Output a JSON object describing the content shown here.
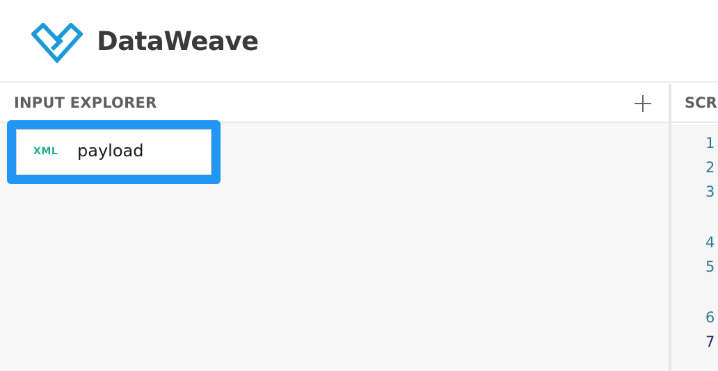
{
  "header": {
    "brand": "DataWeave",
    "logo_icon": "dataweave-logo-icon",
    "logo_color": "#1a9bd7"
  },
  "input_explorer": {
    "title": "INPUT EXPLORER",
    "add_icon": "plus-icon",
    "items": [
      {
        "type": "XML",
        "name": "payload",
        "selected": true
      }
    ],
    "selection_color": "#2196f3",
    "badge_color": "#1fae8c"
  },
  "script_panel": {
    "title": "SCRIPT",
    "line_numbers": [
      "1",
      "2",
      "3",
      "4",
      "5",
      "6",
      "7"
    ]
  }
}
